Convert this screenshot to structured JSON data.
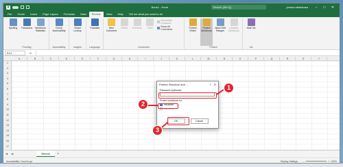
{
  "window": {
    "title": "Book1 - Excel",
    "search": "Search (Alt+Q)",
    "user": "joshua rakalamsa",
    "min": "–",
    "max": "□",
    "close": "✕"
  },
  "tabs": [
    "File",
    "Home",
    "Insert",
    "Page Layout",
    "Formulas",
    "Data",
    "Review",
    "View",
    "Help"
  ],
  "active_tab": "Review",
  "tell_me": "Tell me what you want to do",
  "ribbon": {
    "proofing": {
      "label": "Proofing",
      "items": [
        "Spelling",
        "Thesaurus",
        "Workbook Statistics"
      ]
    },
    "accessibility": {
      "label": "Accessibility",
      "items": [
        "Check Accessibility"
      ]
    },
    "insights": {
      "label": "Insights",
      "items": [
        "Smart Lookup"
      ]
    },
    "language": {
      "label": "Language",
      "items": [
        "Translate"
      ]
    },
    "comments": {
      "label": "Comments",
      "items": [
        "New Comment",
        "Delete",
        "Previous",
        "Next"
      ],
      "small": [
        "Show/Hide Comment",
        "Show All Comments"
      ]
    },
    "protect": {
      "label": "Protect",
      "items": [
        "Protect Sheet",
        "Protect Workbook",
        "Allow Edit Ranges",
        "Unshare Workbook"
      ]
    },
    "ink": {
      "label": "Ink",
      "items": [
        "Hide Ink"
      ]
    }
  },
  "formula_bar": {
    "name_box": "K14",
    "fx": "fx"
  },
  "columns": [
    "A",
    "B",
    "C",
    "D",
    "E",
    "F",
    "G",
    "H",
    "I",
    "J",
    "K",
    "L",
    "M",
    "N",
    "O",
    "P",
    "Q",
    "R",
    "S",
    "T"
  ],
  "rows": [
    "1",
    "2",
    "3",
    "4",
    "5",
    "6",
    "7",
    "8",
    "9",
    "10",
    "11",
    "12",
    "13",
    "14",
    "15",
    "16",
    "17"
  ],
  "sheet_tab": "Sheet1",
  "add_sheet": "+",
  "status": {
    "accessibility": "Accessibility: Good to go",
    "display": "Display Settings",
    "zoom": "100%"
  },
  "dialog": {
    "title": "Protect Structure and ...",
    "help": "?",
    "close": "✕",
    "password_label": "Password (optional):",
    "protect_label": "Protect workbook for",
    "structure": "Structure",
    "windows": "Windows",
    "check": "✓",
    "ok": "OK",
    "cancel": "Cancel"
  },
  "callouts": [
    "1",
    "2",
    "3"
  ],
  "colors": {
    "excel_green": "#1e6e3f",
    "callout_red": "#e2262d"
  }
}
